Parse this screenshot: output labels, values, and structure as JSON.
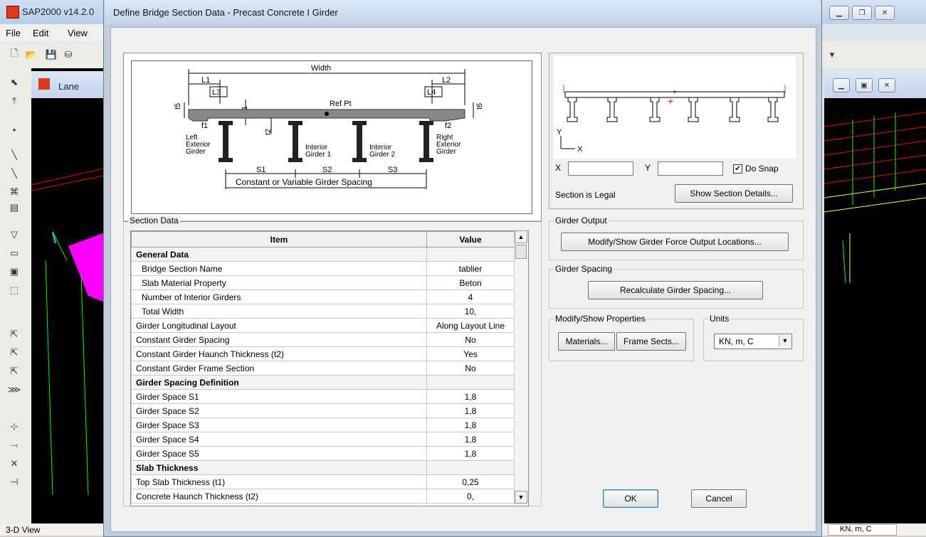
{
  "app": {
    "title": "SAP2000 v14.2.0",
    "menu": [
      "File",
      "Edit",
      "View"
    ],
    "subwindow_title": "Lane",
    "status_view": "3-D View",
    "units_status": "KN, m, C"
  },
  "dialog": {
    "title": "Define Bridge Section Data - Precast Concrete I Girder",
    "diagram": {
      "width_label": "Width",
      "l1": "L1",
      "l2": "L2",
      "l3": "L3",
      "l4": "L4",
      "t1": "t1",
      "t2": "t2",
      "t5": "t5",
      "t6": "t6",
      "f1": "f1",
      "f2": "f2",
      "ref_pt": "Ref Pt",
      "left_ext": "Left\nExterior\nGirder",
      "int1": "Interior\nGirder 1",
      "int2": "Interior\nGirder 2",
      "right_ext": "Right\nExterior\nGirder",
      "s1": "S1",
      "s2": "S2",
      "s3": "S3",
      "spacing_caption": "Constant or Variable Girder Spacing"
    },
    "preview": {
      "y_axis": "Y",
      "x_axis": "X",
      "x_label": "X",
      "y_label": "Y",
      "x_value": "",
      "y_value": "",
      "do_snap_label": "Do Snap",
      "do_snap_checked": true,
      "status": "Section is Legal",
      "show_details_button": "Show Section Details..."
    },
    "section_data": {
      "label": "Section Data",
      "columns": [
        "Item",
        "Value"
      ],
      "rows": [
        {
          "item": "General Data",
          "value": "",
          "kind": "head"
        },
        {
          "item": "Bridge Section Name",
          "value": "tablier",
          "kind": "sub"
        },
        {
          "item": "Slab Material Property",
          "value": "Beton",
          "kind": "sub"
        },
        {
          "item": "Number of Interior Girders",
          "value": "4",
          "kind": "sub"
        },
        {
          "item": "Total Width",
          "value": "10,",
          "kind": "sub"
        },
        {
          "item": "Girder Longitudinal Layout",
          "value": "Along Layout Line",
          "kind": "row"
        },
        {
          "item": "Constant Girder Spacing",
          "value": "No",
          "kind": "row"
        },
        {
          "item": "Constant Girder Haunch Thickness (t2)",
          "value": "Yes",
          "kind": "row"
        },
        {
          "item": "Constant Girder Frame Section",
          "value": "No",
          "kind": "row"
        },
        {
          "item": "Girder Spacing Definition",
          "value": "",
          "kind": "head"
        },
        {
          "item": "Girder Space S1",
          "value": "1,8",
          "kind": "row"
        },
        {
          "item": "Girder Space S2",
          "value": "1,8",
          "kind": "row"
        },
        {
          "item": "Girder Space S3",
          "value": "1,8",
          "kind": "row"
        },
        {
          "item": "Girder Space S4",
          "value": "1,8",
          "kind": "row"
        },
        {
          "item": "Girder Space S5",
          "value": "1,8",
          "kind": "row"
        },
        {
          "item": "Slab Thickness",
          "value": "",
          "kind": "head"
        },
        {
          "item": "Top Slab Thickness (t1)",
          "value": "0,25",
          "kind": "row"
        },
        {
          "item": "Concrete Haunch Thickness (t2)",
          "value": "0,",
          "kind": "row"
        }
      ]
    },
    "girder_output": {
      "label": "Girder Output",
      "button": "Modify/Show Girder Force Output Locations..."
    },
    "girder_spacing": {
      "label": "Girder Spacing",
      "button": "Recalculate Girder Spacing..."
    },
    "properties": {
      "label": "Modify/Show Properties",
      "materials_button": "Materials...",
      "frame_button": "Frame Sects..."
    },
    "units": {
      "label": "Units",
      "value": "KN, m, C"
    },
    "ok_button": "OK",
    "cancel_button": "Cancel"
  }
}
